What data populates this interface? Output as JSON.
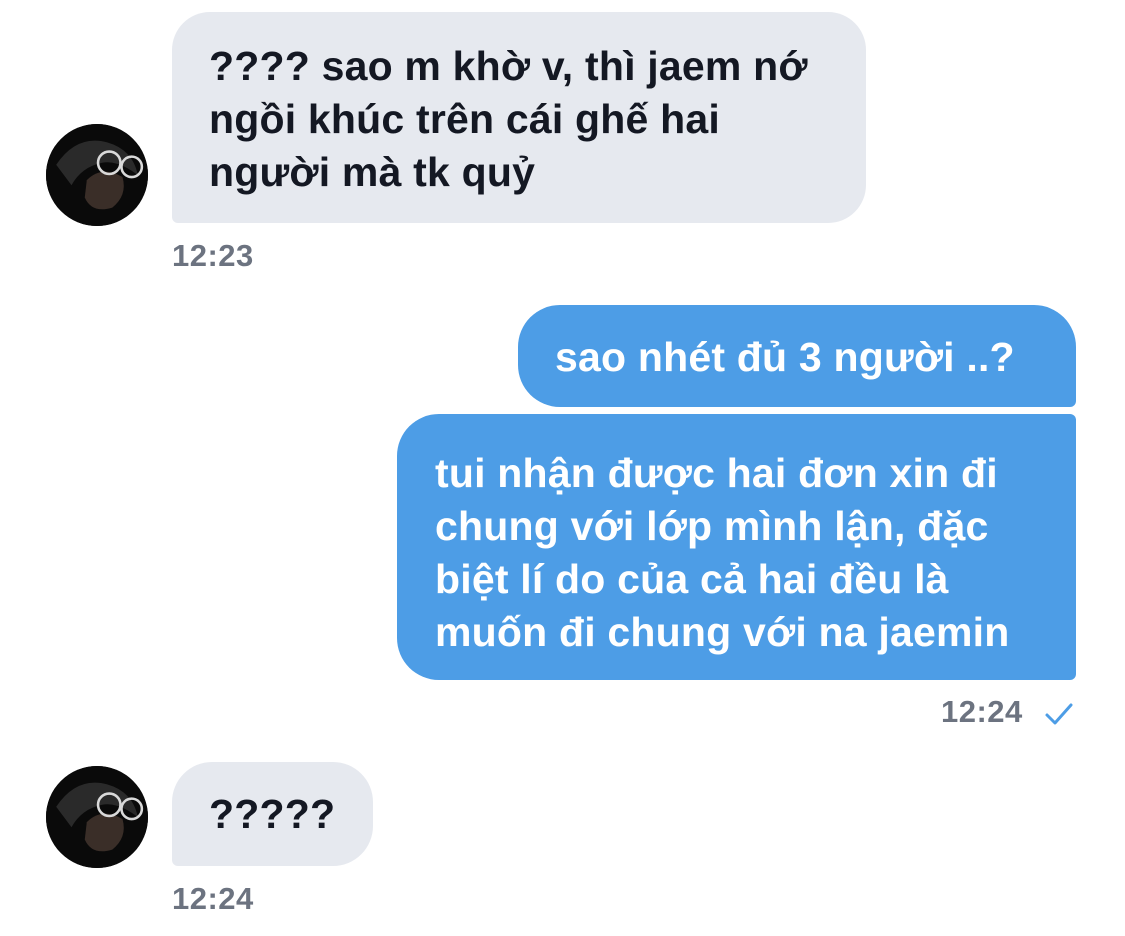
{
  "messages": [
    {
      "direction": "incoming",
      "text": "???? sao m khờ v, thì jaem nớ\nngồi khúc trên cái ghế hai\nngười mà tk quỷ",
      "time": "12:23"
    },
    {
      "direction": "outgoing",
      "text": "sao nhét đủ 3 người ..?"
    },
    {
      "direction": "outgoing",
      "text": "tui nhận được hai đơn xin đi\nchung với lớp mình lận, đặc\nbiệt lí do của cả hai đều là\nmuốn đi chung với na jaemin",
      "time": "12:24",
      "status_icon": "check-icon"
    },
    {
      "direction": "incoming",
      "text": "?????",
      "time": "12:24"
    }
  ],
  "colors": {
    "incoming_bubble": "#e6e9ef",
    "outgoing_bubble": "#4d9de6",
    "timestamp": "#6c7380",
    "check": "#4d9de6"
  }
}
